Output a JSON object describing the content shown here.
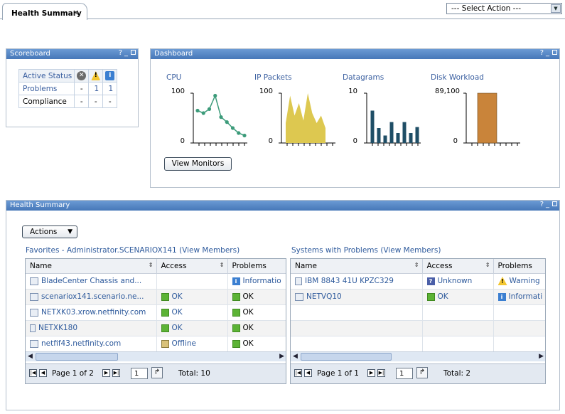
{
  "tab": {
    "title": "Health Summary",
    "close": "×"
  },
  "select_action": {
    "value": "--- Select Action ---"
  },
  "scoreboard": {
    "title": "Scoreboard",
    "header_label": "Active Status",
    "rows": [
      {
        "label": "Problems",
        "c1": "-",
        "c2": "1",
        "c3": "1"
      },
      {
        "label": "Compliance",
        "c1": "-",
        "c2": "-",
        "c3": "-"
      }
    ]
  },
  "panel_controls": {
    "help": "?",
    "min": "_"
  },
  "dashboard": {
    "title": "Dashboard",
    "view_monitors": "View Monitors",
    "charts": [
      {
        "title": "CPU",
        "ymax": "100",
        "ymin": "0"
      },
      {
        "title": "IP Packets",
        "ymax": "100",
        "ymin": "0"
      },
      {
        "title": "Datagrams",
        "ymax": "10",
        "ymin": "0"
      },
      {
        "title": "Disk Workload",
        "ymax": "89,100",
        "ymin": "0"
      }
    ]
  },
  "chart_data": [
    {
      "type": "line",
      "title": "CPU",
      "ylim": [
        0,
        100
      ],
      "values": [
        65,
        60,
        68,
        95,
        52,
        42,
        30,
        20,
        15
      ]
    },
    {
      "type": "area",
      "title": "IP Packets",
      "ylim": [
        0,
        100
      ],
      "values": [
        40,
        95,
        55,
        80,
        45,
        100,
        60,
        40,
        55,
        30
      ]
    },
    {
      "type": "bar",
      "title": "Datagrams",
      "ylim": [
        0,
        10
      ],
      "values": [
        6.5,
        3,
        1.5,
        4.2,
        2,
        4.2,
        2,
        3.2
      ]
    },
    {
      "type": "bar",
      "title": "Disk Workload",
      "ylim": [
        0,
        89100
      ],
      "values": [
        89100
      ]
    }
  ],
  "health": {
    "title": "Health Summary",
    "actions": "Actions",
    "favorites_title": "Favorites - Administrator.SCENARIOX141 (View Members)",
    "problems_title": "Systems with Problems (View Members)",
    "fav_columns": [
      "Name",
      "Access",
      "Problems"
    ],
    "fav_rows": [
      {
        "name": "BladeCenter Chassis and...",
        "access": "",
        "problems": "Informatio",
        "picon": "info"
      },
      {
        "name": "scenariox141.scenario.ne...",
        "access": "OK",
        "problems": "OK",
        "picon": "ok"
      },
      {
        "name": "NETXK03.xrow.netfinity.com",
        "access": "OK",
        "problems": "OK",
        "picon": "ok"
      },
      {
        "name": "NETXK180",
        "access": "OK",
        "problems": "OK",
        "picon": "ok"
      },
      {
        "name": "netfif43.netfinity.com",
        "access": "Offline",
        "problems": "OK",
        "picon": "ok"
      }
    ],
    "prob_columns": [
      "Name",
      "Access",
      "Problems"
    ],
    "prob_rows": [
      {
        "name": "IBM 8843 41U KPZC329",
        "access": "Unknown",
        "problems": "Warning"
      },
      {
        "name": "NETVQ10",
        "access": "OK",
        "problems": "Informati"
      }
    ],
    "fav_pager": {
      "page": "Page 1 of 2",
      "input": "1",
      "total": "Total: 10"
    },
    "prob_pager": {
      "page": "Page 1 of 1",
      "input": "1",
      "total": "Total: 2"
    }
  }
}
